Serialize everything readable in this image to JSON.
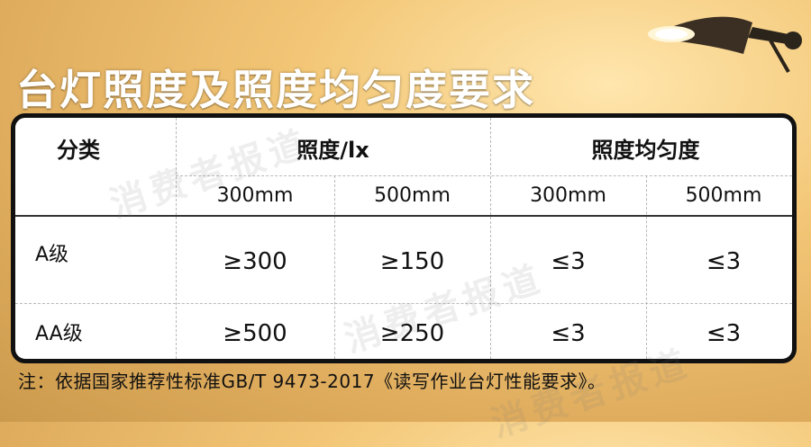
{
  "title": "台灯照度及照度均匀度要求",
  "table": {
    "header_category": "分类",
    "header_illuminance": "照度/lx",
    "header_uniformity": "照度均匀度",
    "sub_headers": [
      "300mm",
      "500mm",
      "300mm",
      "500mm"
    ],
    "rows": [
      {
        "label": "A级",
        "values": [
          "≥300",
          "≥150",
          "≤3",
          "≤3"
        ]
      },
      {
        "label": "AA级",
        "values": [
          "≥500",
          "≥250",
          "≤3",
          "≤3"
        ]
      }
    ]
  },
  "watermark": "消费者报道",
  "note": "注：依据国家推荐性标准GB/T 9473-2017《读写作业台灯性能要求》。",
  "colors": {
    "accent_bg": "#f3c777",
    "panel_border": "#111111",
    "title_text": "#ffffff"
  },
  "icons": {
    "lamp": "desk-lamp-icon"
  }
}
